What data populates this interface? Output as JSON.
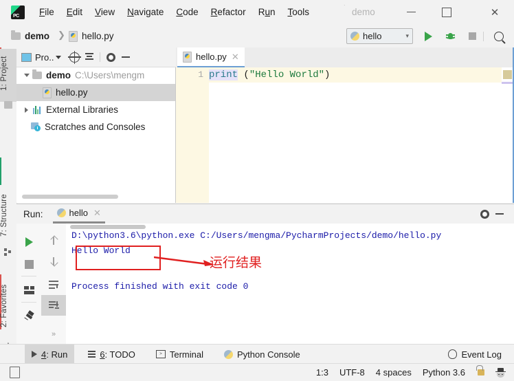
{
  "window": {
    "app_logo": "pycharm-logo",
    "project_title": "demo",
    "minimize_label": "minimize-icon",
    "maximize_label": "maximize-icon",
    "close_label": "✕"
  },
  "menubar": {
    "items": [
      {
        "label": "File",
        "mnemonic": "F"
      },
      {
        "label": "Edit",
        "mnemonic": "E"
      },
      {
        "label": "View",
        "mnemonic": "V"
      },
      {
        "label": "Navigate",
        "mnemonic": "N"
      },
      {
        "label": "Code",
        "mnemonic": "C"
      },
      {
        "label": "Refactor",
        "mnemonic": "R"
      },
      {
        "label": "Run",
        "mnemonic": "u"
      },
      {
        "label": "Tools",
        "mnemonic": "T"
      }
    ]
  },
  "navbar": {
    "breadcrumb": [
      {
        "label": "demo",
        "icon": "folder-icon"
      },
      {
        "label": "hello.py",
        "icon": "python-file-icon"
      }
    ],
    "run_config": {
      "label": "hello",
      "icon": "python-icon",
      "chevron": "⌄"
    },
    "buttons": [
      {
        "name": "run-button",
        "icon": "play-icon"
      },
      {
        "name": "debug-button",
        "icon": "bug-icon"
      },
      {
        "name": "stop-button",
        "icon": "stop-icon"
      },
      {
        "name": "search-everywhere-button",
        "icon": "search-icon"
      }
    ]
  },
  "left_tool_strip": {
    "tabs": [
      {
        "label": "1: Project",
        "active": true,
        "icon": "project-folder-icon"
      },
      {
        "label": "7: Structure",
        "active": false,
        "icon": "structure-icon"
      },
      {
        "label": "2: Favorites",
        "active": false,
        "icon": "star-icon"
      }
    ]
  },
  "project_panel": {
    "title": "Pro..",
    "toolbar": [
      {
        "name": "project-view-selector",
        "label": "Pro.."
      },
      {
        "name": "locate-file-button",
        "icon": "crosshair-icon"
      },
      {
        "name": "collapse-all-button",
        "icon": "collapse-icon"
      },
      {
        "name": "settings-button",
        "icon": "gear-icon"
      },
      {
        "name": "hide-button",
        "icon": "minus-icon"
      }
    ],
    "tree": [
      {
        "label": "demo",
        "path": "C:\\Users\\mengm",
        "expanded": true,
        "bold": true,
        "icon": "folder-icon",
        "indent": 0
      },
      {
        "label": "hello.py",
        "selected": true,
        "icon": "python-file-icon",
        "indent": 1
      },
      {
        "label": "External Libraries",
        "expanded": false,
        "icon": "library-icon",
        "indent": 0
      },
      {
        "label": "Scratches and Consoles",
        "icon": "scratches-icon",
        "indent": 0
      }
    ]
  },
  "editor": {
    "tabs": [
      {
        "label": "hello.py",
        "icon": "python-file-icon",
        "active": true,
        "close": "✕"
      }
    ],
    "line_numbers": [
      "1"
    ],
    "code": {
      "keyword": "print",
      "space": " ",
      "open_paren": "(",
      "string": "\"Hello World\"",
      "close_paren": ")"
    }
  },
  "run_panel": {
    "header_label": "Run:",
    "tab": {
      "label": "hello",
      "icon": "python-icon",
      "close": "✕"
    },
    "toolbar": [
      {
        "name": "rerun-button",
        "icon": "play-icon"
      },
      {
        "name": "stop-process-button",
        "icon": "stop-icon"
      },
      {
        "name": "restore-layout-button",
        "icon": "layout-icon"
      },
      {
        "name": "pin-tab-button",
        "icon": "pin-icon"
      },
      {
        "name": "up-stacktrace-button",
        "icon": "arrow-up-icon"
      },
      {
        "name": "down-stacktrace-button",
        "icon": "arrow-down-icon"
      },
      {
        "name": "soft-wrap-button",
        "icon": "soft-wrap-icon"
      },
      {
        "name": "scroll-to-end-button",
        "icon": "scroll-end-icon"
      },
      {
        "name": "more-button",
        "icon": "chevron-double-icon"
      }
    ],
    "settings_icon": "gear-icon",
    "hide_icon": "minus-icon",
    "console_lines": [
      "D:\\python3.6\\python.exe C:/Users/mengma/PycharmProjects/demo/hello.py",
      "Hello World",
      "Process finished with exit code 0"
    ],
    "annotation": {
      "text": "运行结果",
      "color": "#e02020",
      "box_target": "Hello World"
    }
  },
  "bottom_bar": {
    "items": [
      {
        "label": "4: Run",
        "mnemonic": "4",
        "icon": "play-icon",
        "active": true
      },
      {
        "label": "6: TODO",
        "mnemonic": "6",
        "icon": "list-icon",
        "active": false
      },
      {
        "label": "Terminal",
        "icon": "terminal-icon",
        "active": false
      },
      {
        "label": "Python Console",
        "icon": "python-icon",
        "active": false
      }
    ],
    "event_log": {
      "label": "Event Log",
      "icon": "event-log-icon"
    }
  },
  "status_bar": {
    "caret": "1:3",
    "encoding": "UTF-8",
    "indent": "4 spaces",
    "interpreter": "Python 3.6",
    "lock_icon": "unlock-icon",
    "inspector_icon": "hector-icon",
    "left_icon": "document-icon"
  }
}
